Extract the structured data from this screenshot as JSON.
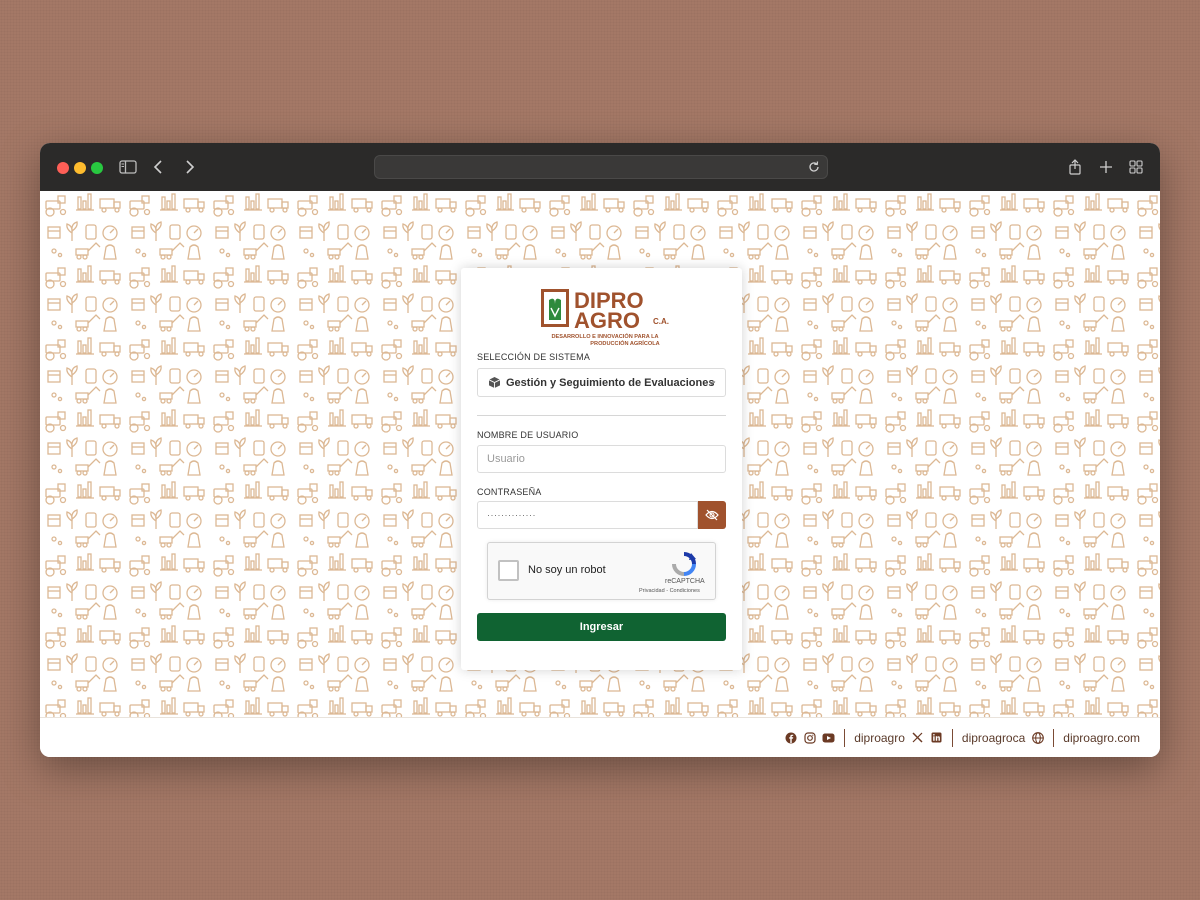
{
  "browser": {
    "url": ""
  },
  "logo": {
    "line1": "DIPRO",
    "line2": "AGRO",
    "suffix": "C.A.",
    "tagline1": "DESARROLLO E INNOVACIÓN PARA LA",
    "tagline2": "PRODUCCIÓN AGRÍCOLA"
  },
  "system_select": {
    "label": "SELECCIÓN DE SISTEMA",
    "value": "Gestión y Seguimiento de Evaluaciones",
    "icon": "box-icon"
  },
  "username": {
    "label": "NOMBRE DE USUARIO",
    "placeholder": "Usuario",
    "value": ""
  },
  "password": {
    "label": "CONTRASEÑA",
    "masked_value": "··············",
    "toggle_icon": "eye-off-icon"
  },
  "captcha": {
    "text": "No soy un robot",
    "brand": "reCAPTCHA",
    "links": "Privacidad - Condiciones"
  },
  "submit": {
    "label": "Ingresar"
  },
  "footer": {
    "social_handle": "diproagro",
    "social_handle_2": "diproagroca",
    "website": "diproagro.com",
    "icons_group_1": [
      "facebook-icon",
      "instagram-icon",
      "youtube-icon"
    ],
    "icons_group_2": [
      "x-icon",
      "linkedin-icon"
    ],
    "icons_group_3": [
      "globe-icon"
    ]
  },
  "colors": {
    "brand_brown": "#a0522d",
    "brand_green": "#106332",
    "pattern": "#d9b590"
  }
}
